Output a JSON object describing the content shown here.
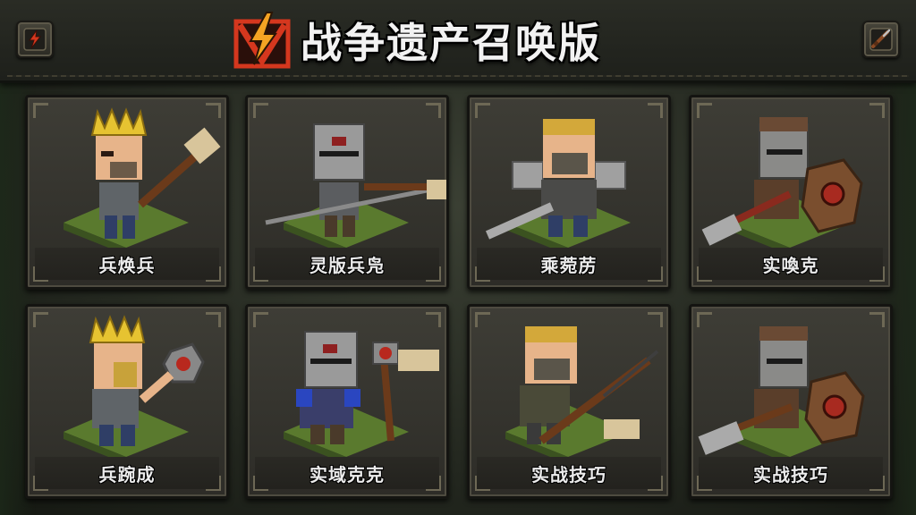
{
  "header": {
    "title": "战争遗产召唤版",
    "left_button_icon": "lightning-icon",
    "right_button_icon": "rifle-icon",
    "logo_icon": "lightning-badge-icon"
  },
  "colors": {
    "accent_red": "#d5371e",
    "accent_orange": "#f5a323",
    "grass": "#5a7a2e"
  },
  "cards": [
    {
      "label": "兵焕兵",
      "hero": "crown-warrior-hammer"
    },
    {
      "label": "灵版兵凫",
      "hero": "helmet-knight-spear"
    },
    {
      "label": "乘菀苈",
      "hero": "blonde-warrior-sword"
    },
    {
      "label": "实喚克",
      "hero": "brown-knight-shield"
    },
    {
      "label": "兵踠成",
      "hero": "crown-warrior-mace"
    },
    {
      "label": "实域克克",
      "hero": "helmet-knight-hammer"
    },
    {
      "label": "实战技巧",
      "hero": "blonde-warrior-rifle"
    },
    {
      "label": "实战技巧",
      "hero": "brown-knight-hammer"
    }
  ]
}
